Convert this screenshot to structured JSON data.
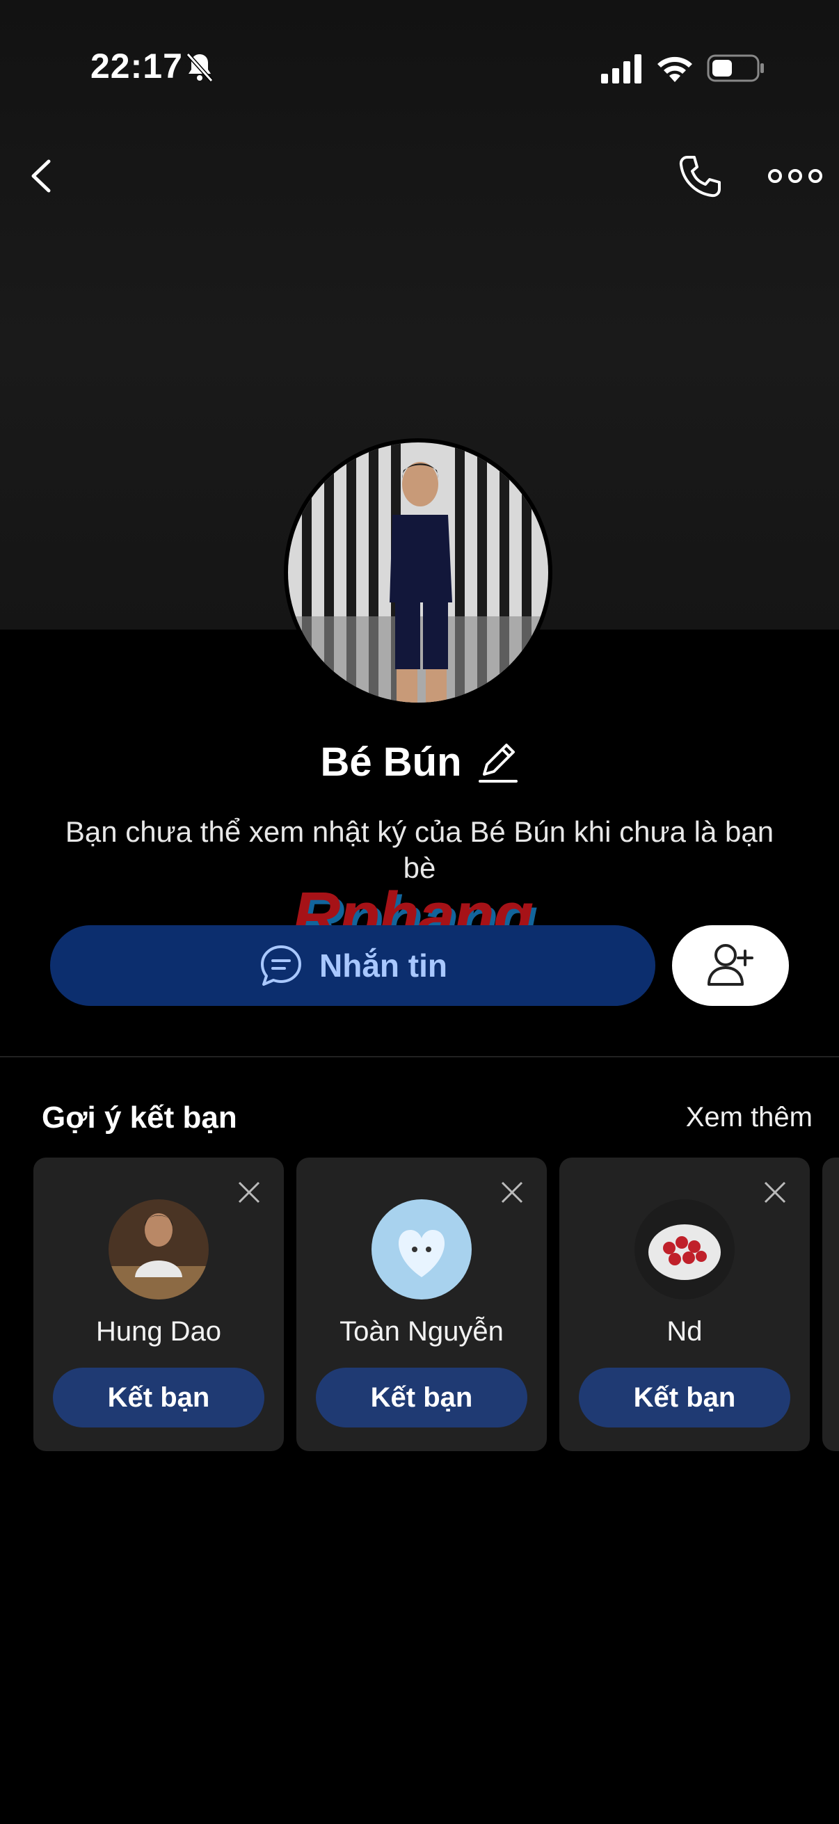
{
  "status_bar": {
    "time": "22:17"
  },
  "profile": {
    "name": "Bé Bún",
    "notice": "Bạn chưa thể xem nhật ký của Bé Bún khi chưa là bạn bè"
  },
  "watermark": "Rphang",
  "actions": {
    "message_label": "Nhắn tin"
  },
  "suggestions": {
    "title": "Gợi ý kết bạn",
    "see_more": "Xem thêm",
    "items": [
      {
        "name": "Hung Dao",
        "button": "Kết bạn"
      },
      {
        "name": "Toàn Nguyễn",
        "button": "Kết bạn"
      },
      {
        "name": "Nd",
        "button": "Kết bạn"
      }
    ]
  },
  "colors": {
    "message_button": "#0c2e6e",
    "message_text": "#a9c8ff",
    "card_background": "#222222",
    "friend_button": "#1f3a73"
  }
}
